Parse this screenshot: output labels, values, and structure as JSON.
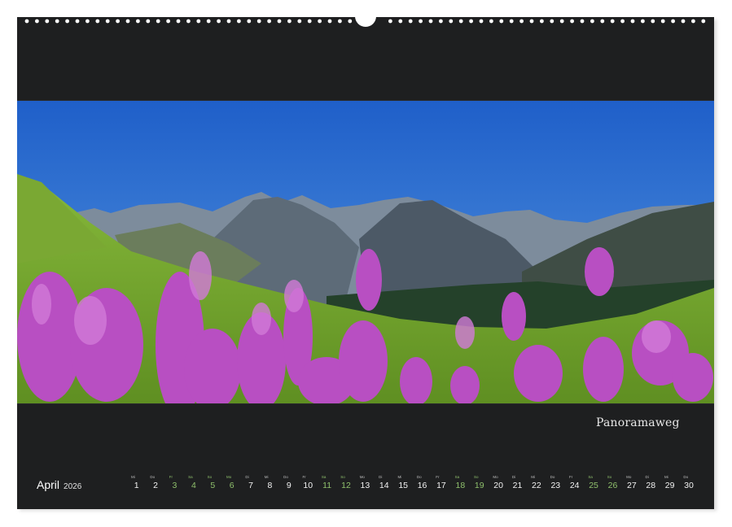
{
  "calendar": {
    "photo_caption": "Panoramaweg",
    "month": "April",
    "year": "2026",
    "accent_color": "#8fc06c",
    "background_color": "#1e1f20",
    "days": [
      {
        "wd": "Mi",
        "n": "1",
        "weekend": false
      },
      {
        "wd": "Do",
        "n": "2",
        "weekend": false
      },
      {
        "wd": "Fr",
        "n": "3",
        "weekend": true
      },
      {
        "wd": "Sa",
        "n": "4",
        "weekend": true
      },
      {
        "wd": "So",
        "n": "5",
        "weekend": true
      },
      {
        "wd": "Mo",
        "n": "6",
        "weekend": true
      },
      {
        "wd": "Di",
        "n": "7",
        "weekend": false
      },
      {
        "wd": "Mi",
        "n": "8",
        "weekend": false
      },
      {
        "wd": "Do",
        "n": "9",
        "weekend": false
      },
      {
        "wd": "Fr",
        "n": "10",
        "weekend": false
      },
      {
        "wd": "Sa",
        "n": "11",
        "weekend": true
      },
      {
        "wd": "So",
        "n": "12",
        "weekend": true
      },
      {
        "wd": "Mo",
        "n": "13",
        "weekend": false
      },
      {
        "wd": "Di",
        "n": "14",
        "weekend": false
      },
      {
        "wd": "Mi",
        "n": "15",
        "weekend": false
      },
      {
        "wd": "Do",
        "n": "16",
        "weekend": false
      },
      {
        "wd": "Fr",
        "n": "17",
        "weekend": false
      },
      {
        "wd": "Sa",
        "n": "18",
        "weekend": true
      },
      {
        "wd": "So",
        "n": "19",
        "weekend": true
      },
      {
        "wd": "Mo",
        "n": "20",
        "weekend": false
      },
      {
        "wd": "Di",
        "n": "21",
        "weekend": false
      },
      {
        "wd": "Mi",
        "n": "22",
        "weekend": false
      },
      {
        "wd": "Do",
        "n": "23",
        "weekend": false
      },
      {
        "wd": "Fr",
        "n": "24",
        "weekend": false
      },
      {
        "wd": "Sa",
        "n": "25",
        "weekend": true
      },
      {
        "wd": "So",
        "n": "26",
        "weekend": true
      },
      {
        "wd": "Mo",
        "n": "27",
        "weekend": false
      },
      {
        "wd": "Di",
        "n": "28",
        "weekend": false
      },
      {
        "wd": "Mi",
        "n": "29",
        "weekend": false
      },
      {
        "wd": "Do",
        "n": "30",
        "weekend": false
      }
    ]
  }
}
